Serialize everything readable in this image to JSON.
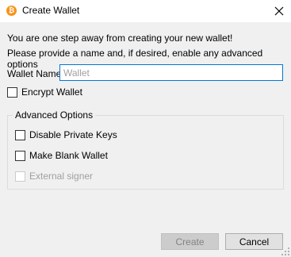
{
  "window": {
    "title": "Create Wallet",
    "app_icon_glyph": "₿",
    "app_icon": "bitcoin-icon",
    "accent_color": "#f7931a"
  },
  "intro": {
    "line1": "You are one step away from creating your new wallet!",
    "line2": "Please provide a name and, if desired, enable any advanced options"
  },
  "wallet_name": {
    "label": "Wallet Name",
    "placeholder": "Wallet",
    "value": ""
  },
  "encrypt": {
    "label": "Encrypt Wallet",
    "checked": false
  },
  "advanced": {
    "title": "Advanced Options",
    "options": [
      {
        "label": "Disable Private Keys",
        "checked": false,
        "enabled": true
      },
      {
        "label": "Make Blank Wallet",
        "checked": false,
        "enabled": true
      },
      {
        "label": "External signer",
        "checked": false,
        "enabled": false
      }
    ]
  },
  "buttons": {
    "create": "Create",
    "cancel": "Cancel"
  }
}
